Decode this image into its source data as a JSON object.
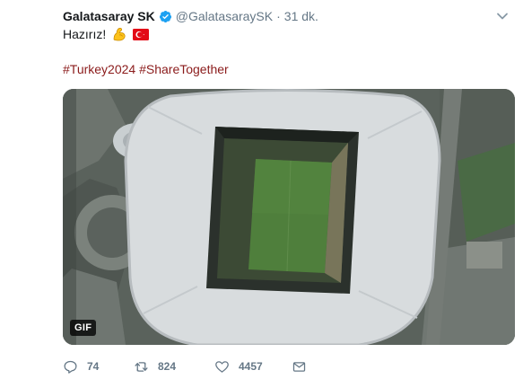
{
  "tweet": {
    "display_name": "Galatasaray SK",
    "handle": "@GalatasaraySK",
    "separator": "·",
    "time": "31 dk.",
    "text": "Hazırız!",
    "hashtags": [
      "#Turkey2024",
      "#ShareTogether"
    ],
    "media_badge": "GIF"
  },
  "actions": {
    "reply_count": "74",
    "retweet_count": "824",
    "like_count": "4457"
  },
  "colors": {
    "hashtag": "#8b1b1b",
    "verified": "#1da1f2",
    "muted": "#657786",
    "flag_red": "#e30a17"
  },
  "icons": [
    "verified-badge-icon",
    "chevron-down-icon",
    "flexed-biceps-emoji-icon",
    "turkey-flag-emoji-icon",
    "reply-icon",
    "retweet-icon",
    "like-heart-icon",
    "direct-message-icon"
  ]
}
